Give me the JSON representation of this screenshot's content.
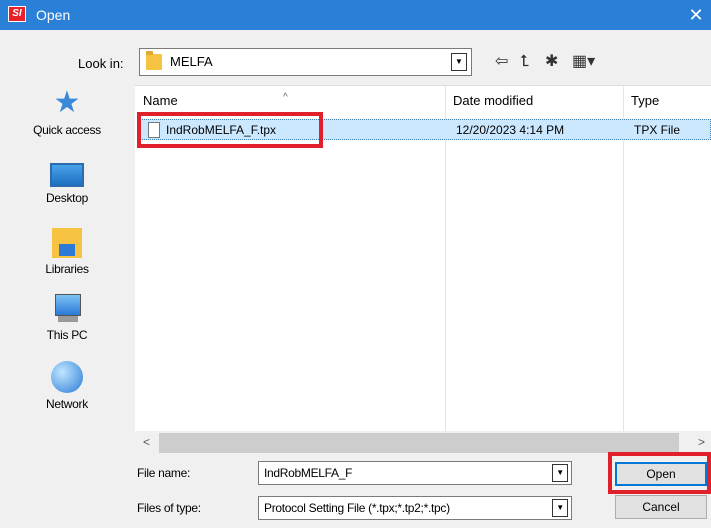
{
  "window": {
    "app_icon_text": "SI",
    "title": "Open",
    "close_glyph": "✕"
  },
  "look_in": {
    "label": "Look in:",
    "value": "MELFA"
  },
  "toolbar": {
    "back_icon": "⇦",
    "up_icon": "⮤",
    "new_folder_icon": "✱",
    "view_menu_icon": "▦▾"
  },
  "places": [
    {
      "label": "Quick access",
      "icon": "star-icon"
    },
    {
      "label": "Desktop",
      "icon": "desktop-icon"
    },
    {
      "label": "Libraries",
      "icon": "libraries-icon"
    },
    {
      "label": "This PC",
      "icon": "computer-icon"
    },
    {
      "label": "Network",
      "icon": "network-icon"
    }
  ],
  "columns": {
    "name": "Name",
    "date_modified": "Date modified",
    "type": "Type",
    "sort_glyph": "^"
  },
  "files": [
    {
      "name": "IndRobMELFA_F.tpx",
      "date_modified": "12/20/2023 4:14 PM",
      "type": "TPX File"
    }
  ],
  "scroll": {
    "left": "<",
    "right": ">"
  },
  "file_name": {
    "label": "File name:",
    "value": "IndRobMELFA_F"
  },
  "file_type": {
    "label": "Files of type:",
    "value": "Protocol Setting File (*.tpx;*.tp2;*.tpc)"
  },
  "buttons": {
    "open": "Open",
    "cancel": "Cancel"
  },
  "highlight_color": "#e0202a",
  "accent_color": "#2a7fd6"
}
